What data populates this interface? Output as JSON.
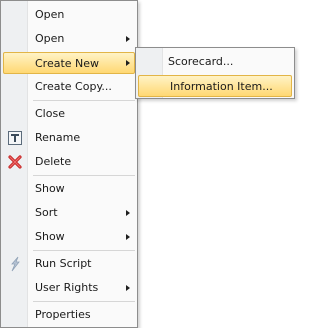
{
  "context_menu": {
    "items": [
      {
        "label": "Open"
      },
      {
        "label": "Open"
      },
      {
        "label": "Create New"
      },
      {
        "label": "Create Copy..."
      },
      {
        "label": "Close"
      },
      {
        "label": "Rename"
      },
      {
        "label": "Delete"
      },
      {
        "label": "Show"
      },
      {
        "label": "Sort"
      },
      {
        "label": "Show"
      },
      {
        "label": "Run Script"
      },
      {
        "label": "User Rights"
      },
      {
        "label": "Properties"
      }
    ]
  },
  "submenu": {
    "items": [
      {
        "label": "Scorecard..."
      },
      {
        "label": "Information Item..."
      }
    ]
  },
  "colors": {
    "highlight_top": "#fff3c6",
    "highlight_bottom": "#ffd873",
    "gutter": "#eef0f2"
  },
  "icons": [
    "rename-icon",
    "delete-icon",
    "run-script-icon"
  ]
}
